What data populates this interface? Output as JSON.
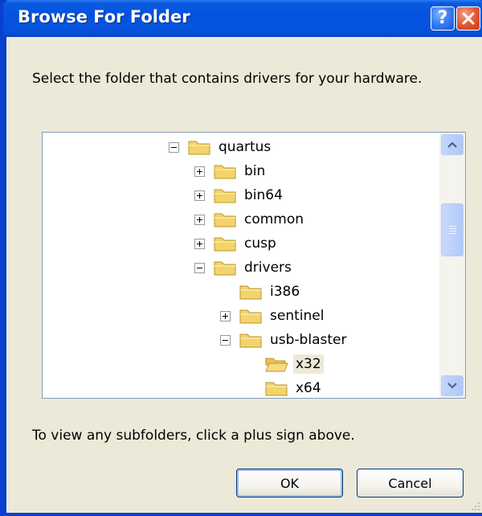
{
  "window": {
    "title": "Browse For Folder",
    "help_button": "?",
    "close_button": "close"
  },
  "dialog": {
    "instruction": "Select the folder that contains drivers for your hardware.",
    "hint": "To view any subfolders, click a plus sign above."
  },
  "tree": {
    "items": [
      {
        "label": "quartus",
        "expander": "minus"
      },
      {
        "label": "bin",
        "expander": "plus"
      },
      {
        "label": "bin64",
        "expander": "plus"
      },
      {
        "label": "common",
        "expander": "plus"
      },
      {
        "label": "cusp",
        "expander": "plus"
      },
      {
        "label": "drivers",
        "expander": "minus"
      },
      {
        "label": "i386",
        "expander": "none"
      },
      {
        "label": "sentinel",
        "expander": "plus"
      },
      {
        "label": "usb-blaster",
        "expander": "minus"
      },
      {
        "label": "x32",
        "expander": "none",
        "selected": true,
        "icon": "folder-open"
      },
      {
        "label": "x64",
        "expander": "none"
      }
    ]
  },
  "buttons": {
    "ok": "OK",
    "cancel": "Cancel"
  },
  "colors": {
    "titlebar": "#0454df",
    "dialog_bg": "#ece9d8",
    "close_button": "#e35a33",
    "folder": "#f3d36b"
  }
}
